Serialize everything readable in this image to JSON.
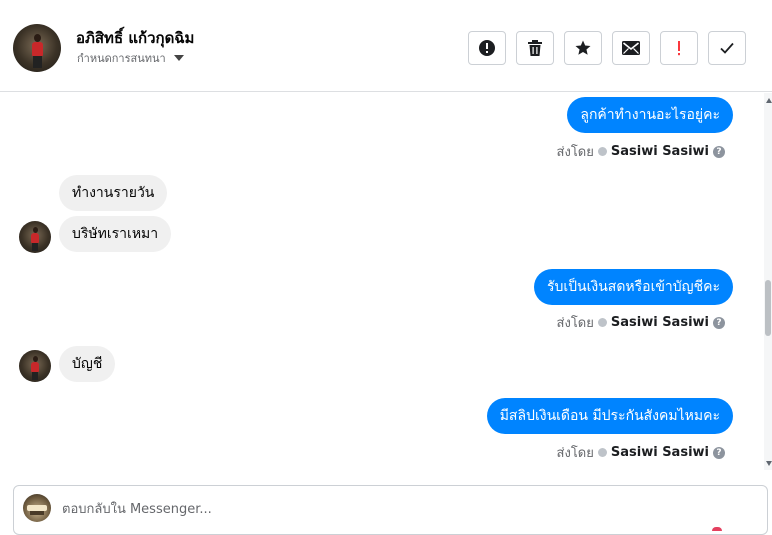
{
  "header": {
    "contact_name": "อภิสิทธิ์ แก้วกุดฉิม",
    "assign_label": "กำหนดการสนทนา",
    "toolbar": [
      {
        "name": "mark-spam-button",
        "icon": "exclamation-circle-icon"
      },
      {
        "name": "delete-button",
        "icon": "trash-icon"
      },
      {
        "name": "star-button",
        "icon": "star-icon"
      },
      {
        "name": "mark-unread-button",
        "icon": "envelope-icon"
      },
      {
        "name": "follow-up-button",
        "icon": "exclamation-icon"
      },
      {
        "name": "mark-done-button",
        "icon": "checkmark-icon"
      }
    ]
  },
  "messages": [
    {
      "direction": "outgoing",
      "text": "ลูกค้าทำงานอะไรอยู่คะ",
      "sent_by_label": "ส่งโดย",
      "sender": "Sasiwi Sasiwi"
    },
    {
      "direction": "incoming",
      "text": "ทำงานรายวัน"
    },
    {
      "direction": "incoming",
      "text": "บริษัทเราเหมา"
    },
    {
      "direction": "outgoing",
      "text": "รับเป็นเงินสดหรือเข้าบัญชีคะ",
      "sent_by_label": "ส่งโดย",
      "sender": "Sasiwi Sasiwi"
    },
    {
      "direction": "incoming",
      "text": "บัญชี"
    },
    {
      "direction": "outgoing",
      "text": "มีสลิปเงินเดือน มีประกันสังคมไหมคะ",
      "sent_by_label": "ส่งโดย",
      "sender": "Sasiwi Sasiwi"
    }
  ],
  "composer": {
    "placeholder": "ตอบกลับใน Messenger...",
    "value": ""
  },
  "colors": {
    "outgoing_bubble": "#0084ff",
    "incoming_bubble": "#f0f0f0",
    "follow_up_red": "#fa383e"
  }
}
